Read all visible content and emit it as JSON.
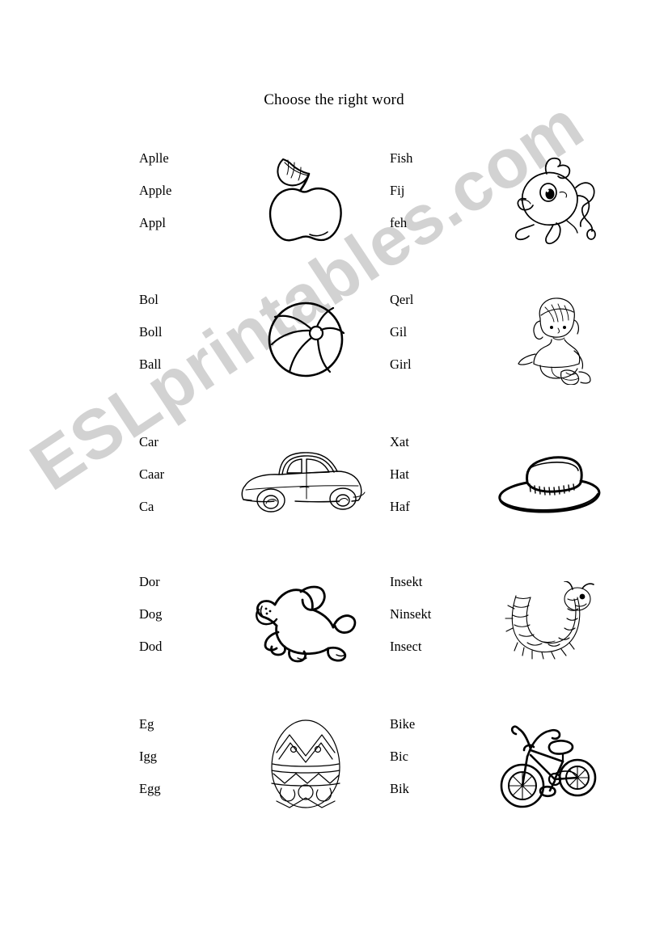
{
  "document": {
    "title": "Choose the right word",
    "watermark": "ESLprintables.com",
    "watermark_color": "#d2d2d2",
    "page_background": "#ffffff",
    "text_color": "#000000"
  },
  "exercises": [
    {
      "picture": "apple-illustration",
      "answer": "Apple",
      "options": [
        "Aplle",
        "Apple",
        "Appl"
      ]
    },
    {
      "picture": "fish-illustration",
      "answer": "Fish",
      "options": [
        "Fish",
        "Fij",
        "feh"
      ]
    },
    {
      "picture": "ball-illustration",
      "answer": "Ball",
      "options": [
        "Bol",
        "Boll",
        "Ball"
      ]
    },
    {
      "picture": "girl-illustration",
      "answer": "Girl",
      "options": [
        "Qerl",
        "Gil",
        "Girl"
      ]
    },
    {
      "picture": "car-illustration",
      "answer": "Car",
      "options": [
        "Car",
        "Caar",
        "Ca"
      ]
    },
    {
      "picture": "hat-illustration",
      "answer": "Hat",
      "options": [
        "Xat",
        "Hat",
        "Haf"
      ]
    },
    {
      "picture": "dog-illustration",
      "answer": "Dog",
      "options": [
        "Dor",
        "Dog",
        "Dod"
      ]
    },
    {
      "picture": "insect-illustration",
      "answer": "Insect",
      "options": [
        "Insekt",
        "Ninsekt",
        "Insect"
      ]
    },
    {
      "picture": "egg-illustration",
      "answer": "Egg",
      "options": [
        "Eg",
        "Igg",
        "Egg"
      ]
    },
    {
      "picture": "bike-illustration",
      "answer": "Bike",
      "options": [
        "Bike",
        "Bic",
        "Bik"
      ]
    }
  ]
}
